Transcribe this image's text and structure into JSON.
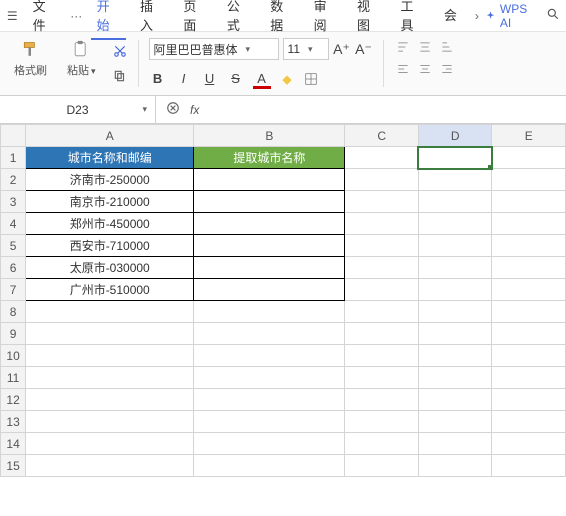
{
  "menu": {
    "file": "文件",
    "more_icon": "···",
    "items": [
      "开始",
      "插入",
      "页面",
      "公式",
      "数据",
      "审阅",
      "视图",
      "工具",
      "会"
    ],
    "active_index": 0,
    "chev": "›",
    "ai_label": "WPS AI"
  },
  "ribbon": {
    "format_painter": "格式刷",
    "paste": "粘贴",
    "paste_chev": "▾",
    "font_name": "阿里巴巴普惠体",
    "font_size": "11",
    "inc_font": "A⁺",
    "dec_font": "A⁻",
    "bold": "B",
    "italic": "I",
    "underline": "U",
    "strike": "S",
    "font_a": "A"
  },
  "formula_bar": {
    "cell_ref": "D23",
    "fx": "fx"
  },
  "columns": [
    "A",
    "B",
    "C",
    "D",
    "E"
  ],
  "active_column": "D",
  "rows": [
    "1",
    "2",
    "3",
    "4",
    "5",
    "6",
    "7",
    "8",
    "9",
    "10",
    "11",
    "12",
    "13",
    "14",
    "15"
  ],
  "headers": {
    "A": "城市名称和邮编",
    "B": "提取城市名称"
  },
  "data_rows": [
    {
      "A": "济南市-250000",
      "B": ""
    },
    {
      "A": "南京市-210000",
      "B": ""
    },
    {
      "A": "郑州市-450000",
      "B": ""
    },
    {
      "A": "西安市-710000",
      "B": ""
    },
    {
      "A": "太原市-030000",
      "B": ""
    },
    {
      "A": "广州市-510000",
      "B": ""
    }
  ],
  "selected_cell": "D1"
}
